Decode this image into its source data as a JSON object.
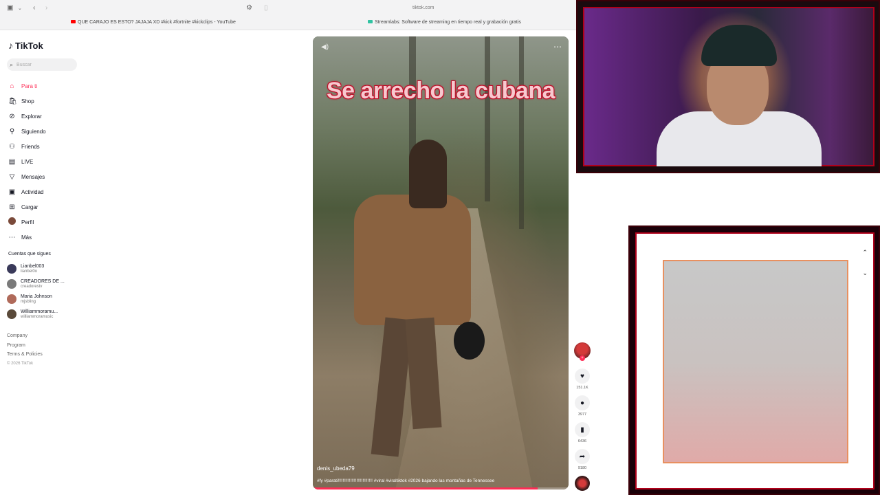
{
  "browser": {
    "url": "tiktok.com",
    "bookmarks": [
      {
        "label": "QUE CARAJO ES ESTO? JAJAJA XD #kick #fortnite #kickclips - YouTube",
        "color": "#ff0000"
      },
      {
        "label": "Streamlabs: Software de streaming en tiempo real y grabación gratis",
        "color": "#31c3a2"
      }
    ]
  },
  "sidebar": {
    "logo": "TikTok",
    "search_placeholder": "Buscar",
    "nav": [
      {
        "label": "Para ti",
        "icon": "home-icon",
        "active": true
      },
      {
        "label": "Shop",
        "icon": "shop-icon"
      },
      {
        "label": "Explorar",
        "icon": "compass-icon"
      },
      {
        "label": "Siguiendo",
        "icon": "following-icon"
      },
      {
        "label": "Friends",
        "icon": "friends-icon"
      },
      {
        "label": "LIVE",
        "icon": "live-icon"
      },
      {
        "label": "Mensajes",
        "icon": "messages-icon"
      },
      {
        "label": "Actividad",
        "icon": "activity-icon"
      },
      {
        "label": "Cargar",
        "icon": "upload-icon"
      },
      {
        "label": "Perfil",
        "icon": "profile-avatar"
      },
      {
        "label": "Más",
        "icon": "more-icon"
      }
    ],
    "following_title": "Cuentas que sigues",
    "following": [
      {
        "name": "Lianbel003",
        "handle": "lianbel0o",
        "color": "#3a3a5a"
      },
      {
        "name": "CREADORES DE ...",
        "handle": "creadorestv",
        "color": "#7a7a7a"
      },
      {
        "name": "Maria Johnson",
        "handle": "mjsbling",
        "color": "#b06a5a"
      },
      {
        "name": "Williammoramu...",
        "handle": "williammoramusic",
        "color": "#5a4a3a"
      }
    ],
    "footer": [
      "Company",
      "Program",
      "Terms & Policies"
    ],
    "copyright": "© 2026 TikTok"
  },
  "video": {
    "overlay_text": "Se arrecho la cubana",
    "author": "denis_ubeda79",
    "caption": "#fy #parati!!!!!!!!!!!!!!!!!!!!!!!!!!!! #viral #viraltiktok #2026 bajando las montañas de Tennessee",
    "progress": 0.88
  },
  "actions": {
    "likes": "151.1K",
    "comments": "3977",
    "saves": "6436",
    "shares": "9180"
  },
  "colors": {
    "accent": "#fe2c55",
    "overlay_border": "#b0001a"
  }
}
